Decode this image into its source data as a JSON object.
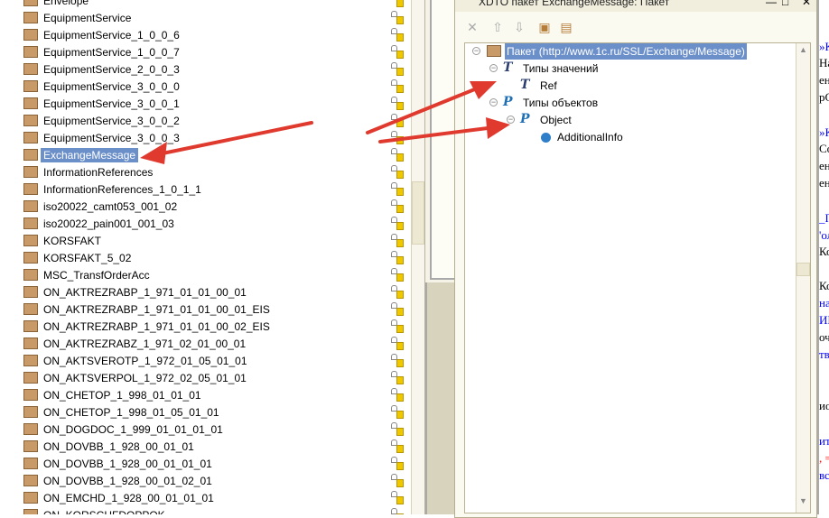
{
  "package_list": {
    "items": [
      "Envelope",
      "EquipmentService",
      "EquipmentService_1_0_0_6",
      "EquipmentService_1_0_0_7",
      "EquipmentService_2_0_0_3",
      "EquipmentService_3_0_0_0",
      "EquipmentService_3_0_0_1",
      "EquipmentService_3_0_0_2",
      "EquipmentService_3_0_0_3",
      "ExchangeMessage",
      "InformationReferences",
      "InformationReferences_1_0_1_1",
      "iso20022_camt053_001_02",
      "iso20022_pain001_001_03",
      "KORSFAKT",
      "KORSFAKT_5_02",
      "MSC_TransfOrderAcc",
      "ON_AKTREZRABP_1_971_01_01_00_01",
      "ON_AKTREZRABP_1_971_01_01_00_01_EIS",
      "ON_AKTREZRABP_1_971_01_01_00_02_EIS",
      "ON_AKTREZRABZ_1_971_02_01_00_01",
      "ON_AKTSVEROTP_1_972_01_05_01_01",
      "ON_AKTSVERPOL_1_972_02_05_01_01",
      "ON_CHETOP_1_998_01_01_01",
      "ON_CHETOP_1_998_01_05_01_01",
      "ON_DOGDOC_1_999_01_01_01_01",
      "ON_DOVBB_1_928_00_01_01",
      "ON_DOVBB_1_928_00_01_01_01",
      "ON_DOVBB_1_928_00_01_02_01",
      "ON_EMCHD_1_928_00_01_01_01",
      "ON_KORSCHFDOPPOK"
    ],
    "selected_index": 9
  },
  "dialog": {
    "title": "XDTO пакет ExchangeMessage: Пакет",
    "toolbar": {
      "delete": "✕",
      "up": "⇧",
      "down": "⇩",
      "check": "▣",
      "import": "▤"
    },
    "tree": {
      "root": "Пакет (http://www.1c.ru/SSL/Exchange/Message)",
      "value_types": "Типы значений",
      "ref": "Ref",
      "object_types": "Типы объектов",
      "object": "Object",
      "additional_info": "AdditionalInfo"
    }
  },
  "code_fragments": [
    "»Ко",
    "Наи",
    "ен",
    "рС",
    "»Ко",
    "Сон",
    "ен",
    "ен",
    "_Пр",
    "'ол",
    "Ко",
    "Ко",
    "нап",
    "ИБ",
    "оче",
    "тва",
    "ио",
    "ити",
    ", =",
    "вст"
  ],
  "colors": {
    "selection": "#6b8fc9",
    "arrow": "#e03a2f"
  }
}
